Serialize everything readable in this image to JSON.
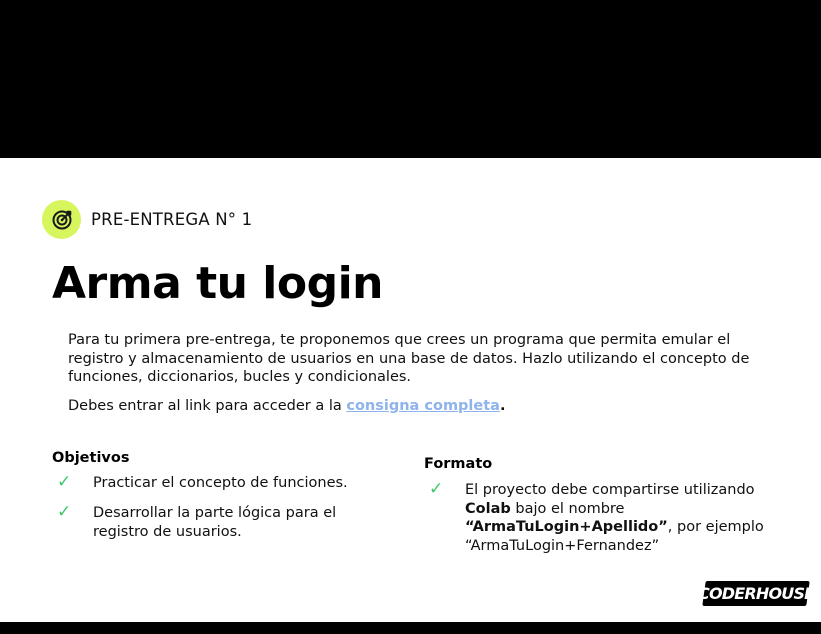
{
  "badge": {
    "label": "PRE-ENTREGA N° 1",
    "icon": "target-icon",
    "color": "#d7f55c"
  },
  "title": "Arma tu login",
  "intro": "Para tu primera pre-entrega, te proponemos que crees un programa que permita emular el registro y almacenamiento de usuarios en una base de datos. Hazlo utilizando el concepto de funciones, diccionarios, bucles y condicionales.",
  "link_line": {
    "prefix": "Debes entrar al link para acceder a la ",
    "link_text": "consigna completa",
    "suffix": "."
  },
  "objetivos": {
    "title": "Objetivos",
    "items": [
      {
        "check": "✓",
        "text": "Practicar el concepto de funciones."
      },
      {
        "check": "✓",
        "text_line1": "Desarrollar  la parte lógica para el",
        "text_line2": "registro de usuarios."
      }
    ]
  },
  "formato": {
    "title": "Formato",
    "check": "✓",
    "line1": "El proyecto debe compartirse utilizando",
    "line2_bold": "Colab",
    "line2_rest": " bajo el nombre",
    "line3_bold": "“ArmaTuLogin+Apellido”",
    "line3_rest": ", por ejemplo",
    "line4": "“ArmaTuLogin+Fernandez”"
  },
  "logo": {
    "text": "CODERHOUSE"
  },
  "colors": {
    "accent": "#d7f55c",
    "check": "#3ec66a",
    "link": "#8fb3ec",
    "band": "#000000"
  }
}
